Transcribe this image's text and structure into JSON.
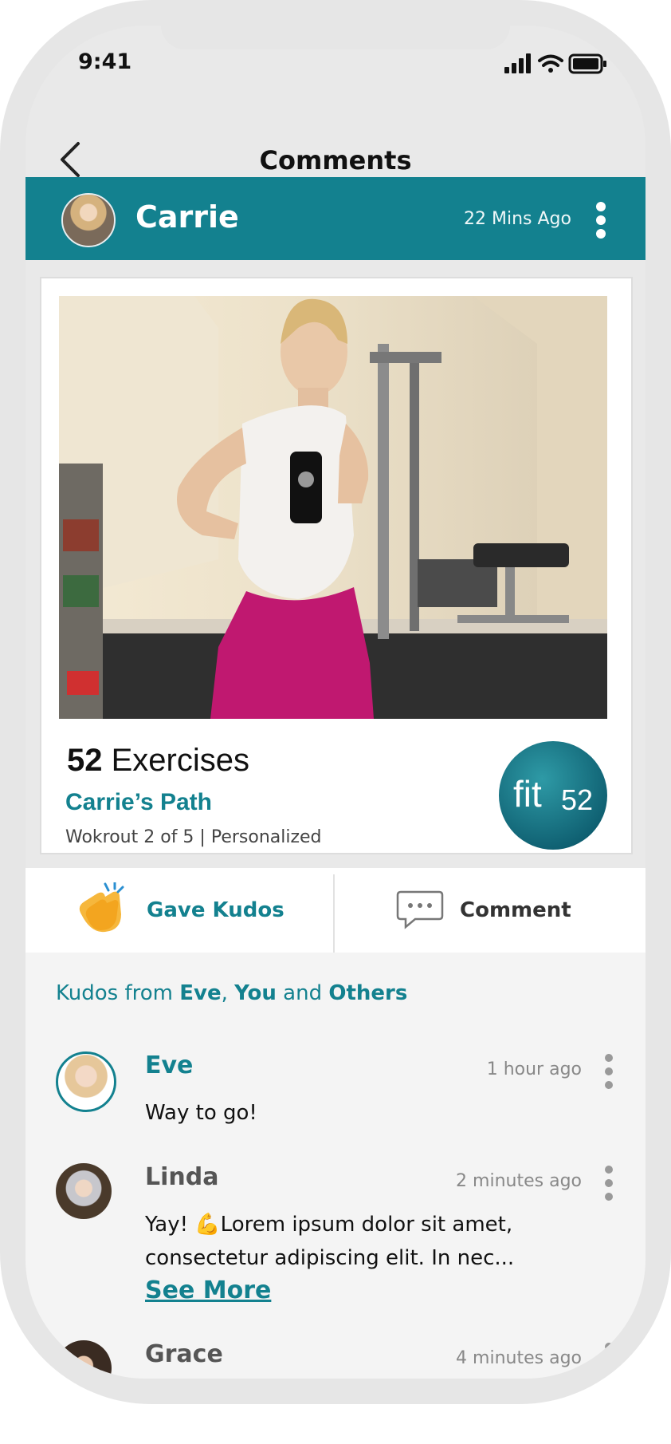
{
  "status_bar": {
    "time": "9:41"
  },
  "nav": {
    "title": "Comments"
  },
  "post": {
    "author": "Carrie",
    "time": "22 Mins Ago",
    "exercise_count": "52",
    "exercise_word": "Exercises",
    "path_name": "Carrie’s Path",
    "workout_detail": "Wokrout 2 of 5 | Personalized",
    "logo_text_main": "fit",
    "logo_text_num": "52"
  },
  "actions": {
    "kudos_label": "Gave Kudos",
    "comment_label": "Comment"
  },
  "kudos_summary": {
    "prefix": "Kudos from ",
    "name1": "Eve",
    "sep1": ", ",
    "name2": "You",
    "sep2": " and ",
    "name3": "Others"
  },
  "comments": [
    {
      "author": "Eve",
      "time": "1 hour ago",
      "text": "Way to go!"
    },
    {
      "author": "Linda",
      "time": "2 minutes ago",
      "text": "Yay! 💪Lorem ipsum dolor sit amet, consectetur adipiscing elit. In nec...",
      "see_more": "See More"
    },
    {
      "author": "Grace",
      "time": "4 minutes ago"
    }
  ],
  "colors": {
    "teal": "#13818f",
    "frame": "#e6e6e6"
  }
}
